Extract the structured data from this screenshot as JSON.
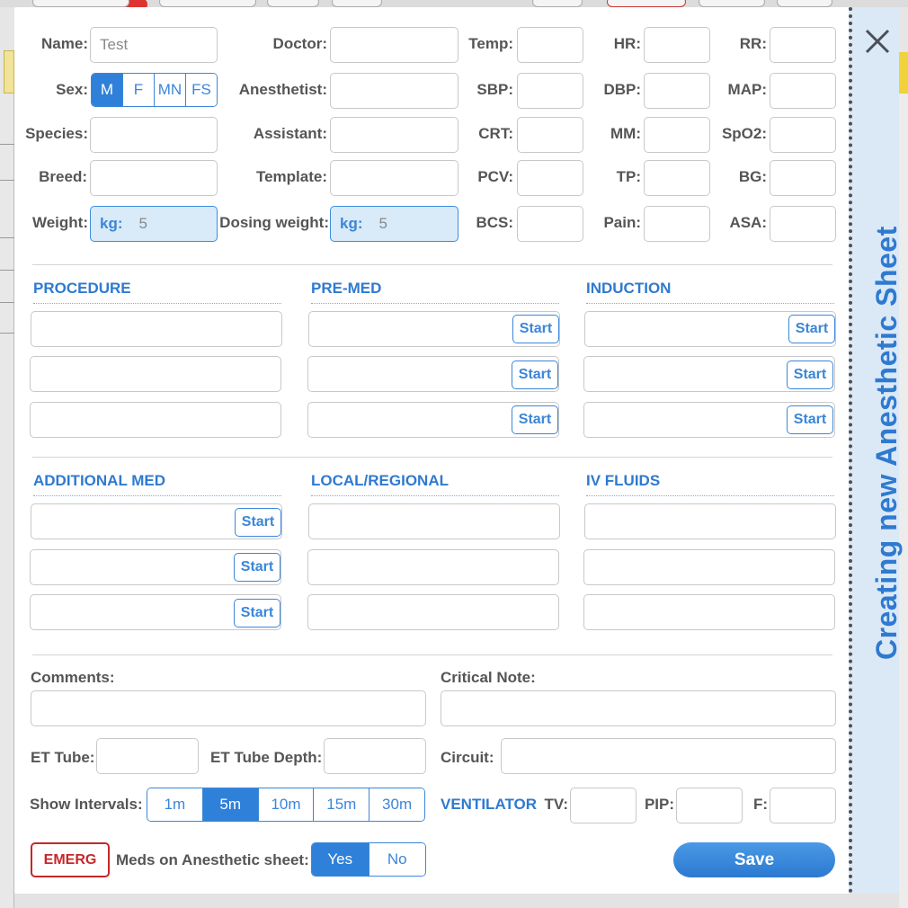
{
  "sheet_title": "Creating new Anesthetic Sheet",
  "patient": {
    "name_label": "Name:",
    "name_value": "Test",
    "sex_label": "Sex:",
    "sex_options": [
      "M",
      "F",
      "MN",
      "FS"
    ],
    "sex_selected": "M",
    "species_label": "Species:",
    "breed_label": "Breed:",
    "weight_label": "Weight:",
    "weight_unit": "kg:",
    "weight_value": "5"
  },
  "staff": {
    "doctor_label": "Doctor:",
    "anesthetist_label": "Anesthetist:",
    "assistant_label": "Assistant:",
    "template_label": "Template:",
    "dosing_weight_label": "Dosing weight:",
    "dosing_weight_unit": "kg:",
    "dosing_weight_value": "5"
  },
  "vitals": {
    "temp": "Temp:",
    "hr": "HR:",
    "rr": "RR:",
    "sbp": "SBP:",
    "dbp": "DBP:",
    "map": "MAP:",
    "crt": "CRT:",
    "mm": "MM:",
    "spo2": "SpO2:",
    "pcv": "PCV:",
    "tp": "TP:",
    "bg": "BG:",
    "bcs": "BCS:",
    "pain": "Pain:",
    "asa": "ASA:"
  },
  "sections": {
    "procedure": "PROCEDURE",
    "premed": "PRE-MED",
    "induction": "INDUCTION",
    "additional_med": "ADDITIONAL MED",
    "local_regional": "LOCAL/REGIONAL",
    "iv_fluids": "IV FLUIDS"
  },
  "start_label": "Start",
  "comments_label": "Comments:",
  "critical_note_label": "Critical Note:",
  "et_tube_label": "ET Tube:",
  "et_tube_depth_label": "ET Tube Depth:",
  "circuit_label": "Circuit:",
  "intervals": {
    "label": "Show Intervals:",
    "options": [
      "1m",
      "5m",
      "10m",
      "15m",
      "30m"
    ],
    "selected": "5m"
  },
  "ventilator": {
    "label": "VENTILATOR",
    "tv": "TV:",
    "pip": "PIP:",
    "f": "F:"
  },
  "emerg_label": "EMERG",
  "meds_on_sheet": {
    "label": "Meds on Anesthetic sheet:",
    "options": [
      "Yes",
      "No"
    ],
    "selected": "Yes"
  },
  "save_label": "Save",
  "colors": {
    "accent": "#2f80d8",
    "side_panel": "#dbe9f7",
    "emerg": "#c62828"
  }
}
